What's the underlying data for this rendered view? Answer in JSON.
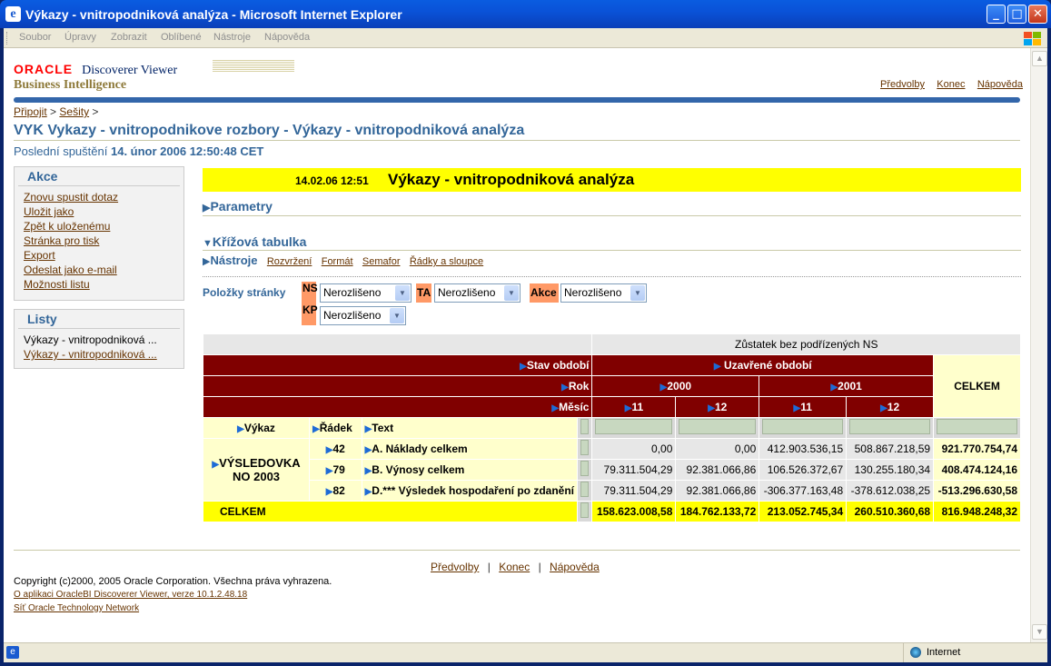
{
  "window": {
    "title": "Výkazy - vnitropodniková analýza - Microsoft Internet Explorer"
  },
  "menu": [
    "Soubor",
    "Úpravy",
    "Zobrazit",
    "Oblíbené",
    "Nástroje",
    "Nápověda"
  ],
  "brand": {
    "oracle": "ORACLE",
    "product": "Discoverer Viewer",
    "bi": "Business Intelligence"
  },
  "toplinks": {
    "prefs": "Předvolby",
    "end": "Konec",
    "help": "Nápověda"
  },
  "breadcrumb": {
    "connect": "Připojit",
    "sep1": ">",
    "workbooks": "Sešity",
    "sep2": ">"
  },
  "page": {
    "title": "VYK Vykazy - vnitropodnikove rozbory - Výkazy - vnitropodniková analýza",
    "lastrun_label": "Poslední spuštění",
    "lastrun_value": "14. únor 2006 12:50:48 CET"
  },
  "actions": {
    "heading": "Akce",
    "items": [
      "Znovu spustit dotaz",
      "Uložit jako",
      "Zpět k uloženému",
      "Stránka pro tisk",
      "Export",
      "Odeslat jako e-mail",
      "Možnosti listu"
    ]
  },
  "sheets": {
    "heading": "Listy",
    "items": [
      "Výkazy - vnitropodniková ...",
      "Výkazy - vnitropodniková ..."
    ]
  },
  "report": {
    "datetime": "14.02.06 12:51",
    "title": "Výkazy - vnitropodniková analýza"
  },
  "sections": {
    "params": "Parametry",
    "crosstab": "Křížová tabulka",
    "tools": "Nástroje"
  },
  "tools": [
    "Rozvržení",
    "Formát",
    "Semafor",
    "Řádky a sloupce"
  ],
  "page_items": {
    "label": "Položky stránky",
    "ns": {
      "tag": "NS",
      "value": "Nerozlišeno"
    },
    "ta": {
      "tag": "TA",
      "value": "Nerozlišeno"
    },
    "akce": {
      "tag": "Akce",
      "value": "Nerozlišeno"
    },
    "kp": {
      "tag": "KP",
      "value": "Nerozlišeno"
    }
  },
  "crosstab": {
    "measure": "Zůstatek bez podřízených NS",
    "stav_label": "Stav období",
    "stav_value": "Uzavřené období",
    "rok_label": "Rok",
    "year1": "2000",
    "year2": "2001",
    "mesic_label": "Měsíc",
    "months": [
      "11",
      "12",
      "11",
      "12"
    ],
    "celkem": "CELKEM",
    "row_headers": {
      "vykaz": "Výkaz",
      "radek": "Řádek",
      "text": "Text"
    },
    "group": "VÝSLEDOVKA NO 2003",
    "rows": [
      {
        "radek": "42",
        "text": "A. Náklady celkem",
        "values": [
          "0,00",
          "0,00",
          "412.903.536,15",
          "508.867.218,59"
        ],
        "total": "921.770.754,74"
      },
      {
        "radek": "79",
        "text": "B. Výnosy celkem",
        "values": [
          "79.311.504,29",
          "92.381.066,86",
          "106.526.372,67",
          "130.255.180,34"
        ],
        "total": "408.474.124,16"
      },
      {
        "radek": "82",
        "text": "D.*** Výsledek hospodaření po zdanění",
        "values": [
          "79.311.504,29",
          "92.381.066,86",
          "-306.377.163,48",
          "-378.612.038,25"
        ],
        "total": "-513.296.630,58"
      }
    ],
    "total_row": {
      "label": "CELKEM",
      "values": [
        "158.623.008,58",
        "184.762.133,72",
        "213.052.745,34",
        "260.510.360,68"
      ],
      "total": "816.948.248,32"
    }
  },
  "footer": {
    "links": [
      "Předvolby",
      "Konec",
      "Nápověda"
    ],
    "sep": "|",
    "copyright": "Copyright (c)2000, 2005 Oracle Corporation. Všechna práva vyhrazena.",
    "about": "O aplikaci OracleBI Discoverer Viewer, verze 10.1.2.48.18",
    "otn": "Síť Oracle Technology Network"
  },
  "status": {
    "zone": "Internet"
  }
}
